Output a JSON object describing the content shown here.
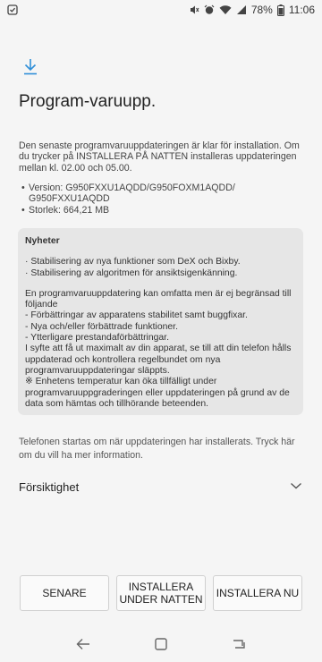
{
  "status_bar": {
    "battery": "78%",
    "time": "11:06",
    "icons": [
      "notification-icon",
      "mute-icon",
      "alarm-icon",
      "wifi-icon",
      "signal-icon",
      "battery-icon"
    ]
  },
  "header": {
    "icon": "download-icon",
    "title": "Program-varuupp."
  },
  "intro": "Den senaste programvaruuppdateringen är klar för installation. Om du trycker på INSTALLERA PÅ NATTEN installeras uppdateringen mellan kl. 02.00 och 05.00.",
  "specs": {
    "version": "Version: G950FXXU1AQDD/G950FOXM1AQDD/ G950FXXU1AQDD",
    "size": "Storlek: 664,21 MB"
  },
  "news": {
    "title": "Nyheter",
    "items": [
      "· Stabilisering av nya funktioner som DeX och Bixby.",
      "· Stabilisering av algoritmen för ansiktsigenkänning."
    ],
    "body_intro": "En programvaruuppdatering kan omfatta men är ej begränsad till följande",
    "body_items": [
      " - Förbättringar av apparatens stabilitet samt buggfixar.",
      " - Nya och/eller förbättrade funktioner.",
      " - Ytterligare prestandaförbättringar."
    ],
    "body_outro": "I syfte att få ut maximalt av din apparat, se till att din telefon hålls uppdaterad och kontrollera regelbundet om nya programvaruuppdateringar släppts.",
    "body_note": "※ Enhetens temperatur kan öka tillfälligt under programvaruuppgraderingen eller uppdateringen på grund av de data som hämtas och tillhörande beteenden."
  },
  "restart_note": "Telefonen startas om när uppdateringen har installerats. Tryck här om du vill ha mer information.",
  "caution": {
    "label": "Försiktighet"
  },
  "buttons": {
    "later": "SENARE",
    "overnight": "INSTALLERA UNDER NATTEN",
    "now": "INSTALLERA NU"
  },
  "nav": {
    "icons": [
      "back-icon",
      "home-icon",
      "recents-icon"
    ]
  }
}
